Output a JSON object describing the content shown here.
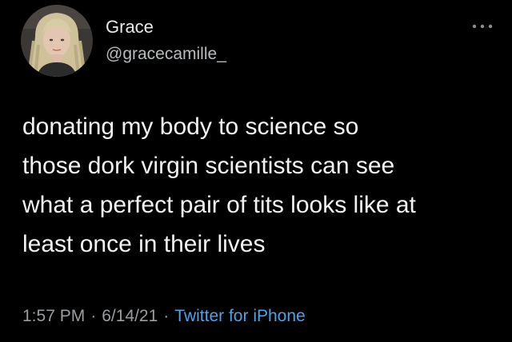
{
  "author": {
    "display_name": "Grace",
    "handle": "@gracecamille_",
    "avatar_icon": "profile-photo"
  },
  "tweet": {
    "lines": [
      "donating my body to science so",
      "those dork virgin scientists can see",
      "what a perfect pair of tits looks like at",
      "least once in their lives"
    ]
  },
  "meta": {
    "time": "1:57 PM",
    "separator": "·",
    "date": "6/14/21",
    "source": "Twitter for iPhone"
  },
  "menu": {
    "icon": "more-options-icon"
  },
  "colors": {
    "background": "#000000",
    "text": "#f2f2f2",
    "secondary": "#9a9da0",
    "link": "#4ba3e8"
  }
}
